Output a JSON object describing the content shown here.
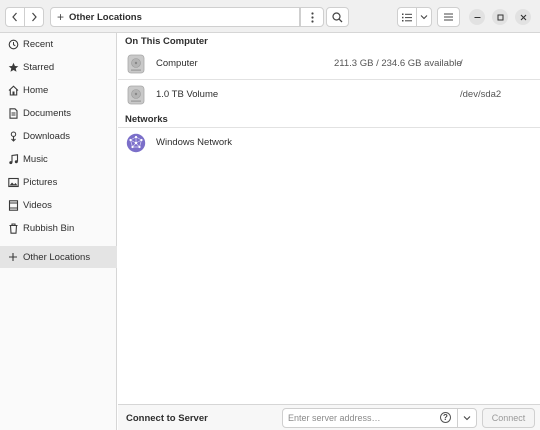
{
  "header": {
    "back_icon": "chevron-left-icon",
    "forward_icon": "chevron-right-icon",
    "location_icon": "plus-icon",
    "location_label": "Other Locations",
    "path_menu_icon": "vertical-dots-icon",
    "search_icon": "search-icon",
    "view_icon": "list-view-icon",
    "view_menu_icon": "chevron-down-icon",
    "menu_icon": "hamburger-icon",
    "window_controls": [
      "minimize",
      "maximize",
      "close"
    ]
  },
  "sidebar": {
    "items": [
      {
        "label": "Recent",
        "icon": "clock-icon"
      },
      {
        "label": "Starred",
        "icon": "star-icon"
      },
      {
        "label": "Home",
        "icon": "home-icon"
      },
      {
        "label": "Documents",
        "icon": "document-icon"
      },
      {
        "label": "Downloads",
        "icon": "download-icon"
      },
      {
        "label": "Music",
        "icon": "music-icon"
      },
      {
        "label": "Pictures",
        "icon": "picture-icon"
      },
      {
        "label": "Videos",
        "icon": "video-icon"
      },
      {
        "label": "Rubbish Bin",
        "icon": "trash-icon"
      }
    ],
    "other_locations": {
      "label": "Other Locations",
      "icon": "plus-icon",
      "active": true
    }
  },
  "main": {
    "computer_section": {
      "title": "On This Computer",
      "rows": [
        {
          "name": "Computer",
          "usage": "211.3 GB / 234.6 GB available",
          "mount": "/",
          "icon": "drive-icon"
        },
        {
          "name": "1.0 TB Volume",
          "usage": "",
          "mount": "/dev/sda2",
          "icon": "drive-icon"
        }
      ]
    },
    "networks_section": {
      "title": "Networks",
      "rows": [
        {
          "name": "Windows Network",
          "icon": "network-icon"
        }
      ]
    }
  },
  "bottom": {
    "title": "Connect to Server",
    "input_placeholder": "Enter server address…",
    "input_value": "",
    "help_icon": "help-icon",
    "dropdown_icon": "chevron-down-icon",
    "connect_label": "Connect"
  },
  "colors": {
    "network_icon": "#7b6fc9",
    "sidebar_active": "#e4e4e4",
    "header_bg": "#f0f0f0"
  }
}
